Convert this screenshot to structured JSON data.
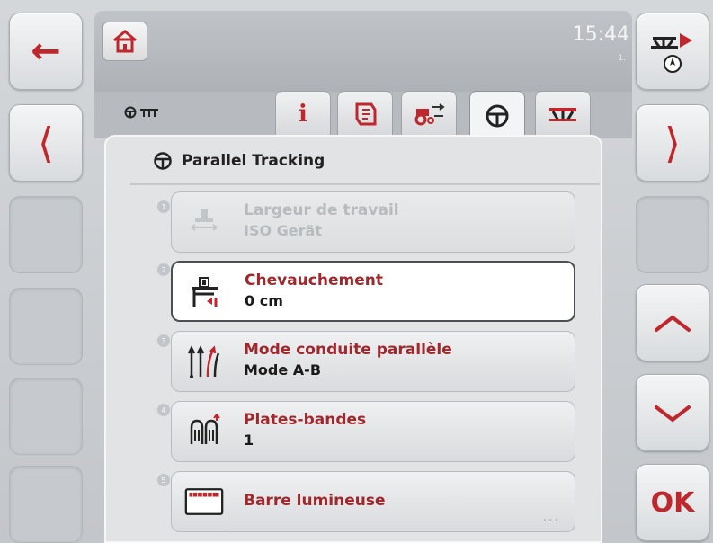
{
  "header": {
    "time": "15:44",
    "sub": "1."
  },
  "breadcrumb": {
    "label": ""
  },
  "panel": {
    "title": "Parallel Tracking"
  },
  "items": [
    {
      "num": "1",
      "label": "Largeur de travail",
      "value": "ISO Gerät",
      "enabled": false
    },
    {
      "num": "2",
      "label": "Chevauchement",
      "value": "0 cm",
      "enabled": true,
      "selected": true
    },
    {
      "num": "3",
      "label": "Mode conduite parallèle",
      "value": "Mode A-B",
      "enabled": true
    },
    {
      "num": "4",
      "label": "Plates-bandes",
      "value": "1",
      "enabled": true
    },
    {
      "num": "5",
      "label": "Barre lumineuse",
      "value": "",
      "enabled": true,
      "more": "..."
    }
  ],
  "buttons": {
    "ok": "OK"
  },
  "colors": {
    "accent": "#c0272d",
    "label_red": "#a0272c",
    "panel_bg": "#e1e3e5"
  },
  "icons": {
    "back": "arrow-left-icon",
    "prev": "chevron-left-icon",
    "next": "chevron-right-icon",
    "up": "chevron-up-icon",
    "down": "chevron-down-icon",
    "home": "home-icon",
    "info": "info-icon",
    "steering": "steering-wheel-icon",
    "implement": "implement-icon",
    "tractor": "tractor-icon",
    "manual": "manual-icon"
  }
}
